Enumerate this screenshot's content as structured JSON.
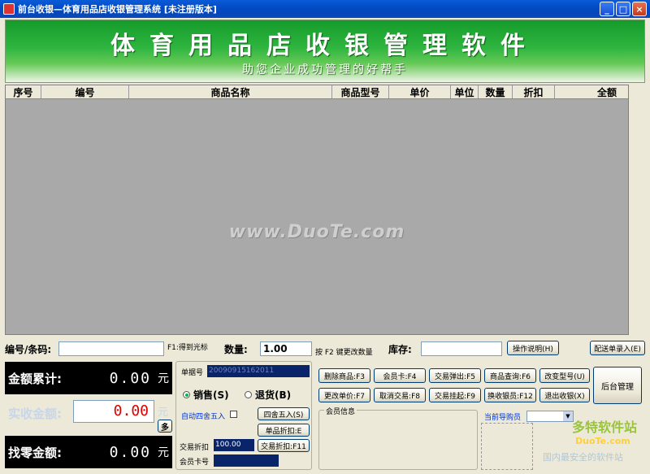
{
  "window": {
    "title": "前台收银—体育用品店收银管理系统 [未注册版本]",
    "min": "_",
    "max": "□",
    "close": "×"
  },
  "banner": {
    "title": "体育用品店收银管理软件",
    "subtitle": "助您企业成功管理的好帮手"
  },
  "grid": {
    "columns": [
      "序号",
      "编号",
      "商品名称",
      "商品型号",
      "单价",
      "单位",
      "数量",
      "折扣",
      "全额"
    ],
    "watermark": "www.DuoTe.com"
  },
  "entry": {
    "code_label": "编号/条码:",
    "code_value": "",
    "code_hint": "F1:得到光标",
    "qty_label": "数量:",
    "qty_value": "1.00",
    "qty_hint": "按 F2 键更改数量",
    "stock_label": "库存:",
    "stock_value": "",
    "help_button": "操作说明(H)",
    "batch_button": "配送单录入(E)"
  },
  "totals": {
    "total_label": "金额累计:",
    "total_value": "0.00",
    "unit": "元",
    "paid_label": "实收金额:",
    "paid_value": "0.00",
    "paid_unit": "元",
    "more_button": "多",
    "change_label": "找零金额:",
    "change_value": "0.00"
  },
  "middle": {
    "bill_label": "单据号",
    "bill_value": "20090915162011",
    "sale_label": "销售(S)",
    "return_label": "退货(B)",
    "auto_round_label": "自动四舍五入",
    "round_button": "四舍五入(S)",
    "item_discount_button": "单品折扣:E",
    "trade_discount_label": "交易折扣",
    "trade_discount_value": "100.00",
    "trade_discount_button": "交易折扣:F11",
    "member_card_label": "会员卡号",
    "member_card_value": ""
  },
  "actions": [
    "删除商品:F3",
    "会员卡:F4",
    "交易弹出:F5",
    "商品查询:F6",
    "改变型号(U)",
    "更改单价:F7",
    "取消交易:F8",
    "交易挂起:F9",
    "换收银员:F12",
    "退出收银(X)"
  ],
  "backend_button": "后台管理",
  "member_info": {
    "label": "会员信息",
    "sales_person_label": "当前导购员"
  },
  "site_logo": {
    "text": "多特软件站",
    "site": "DuoTe.com",
    "slogan": "国内最安全的软件站"
  }
}
